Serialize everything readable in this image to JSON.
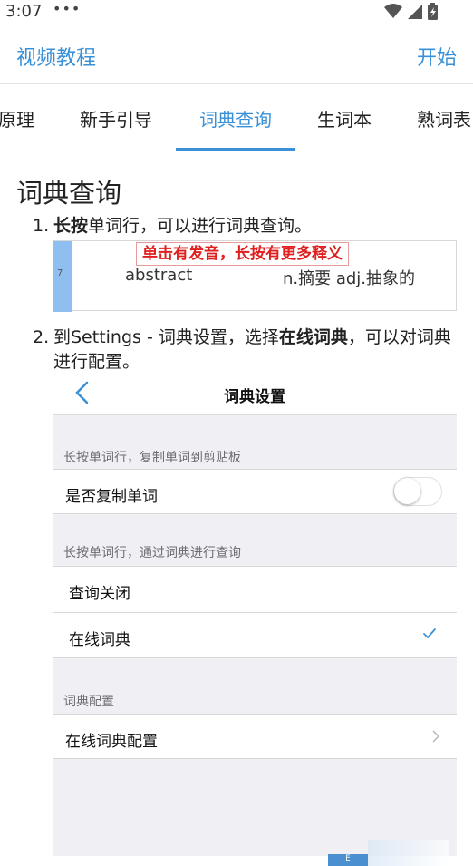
{
  "status_bar": {
    "time": "3:07",
    "dots": "•••"
  },
  "header": {
    "title": "视频教程",
    "action": "开始"
  },
  "tabs": [
    {
      "label": "原理"
    },
    {
      "label": "新手引导"
    },
    {
      "label": "词典查询",
      "active": true
    },
    {
      "label": "生词本"
    },
    {
      "label": "熟词表"
    }
  ],
  "section_title": "词典查询",
  "steps": [
    {
      "num": "1.",
      "bold": "长按",
      "rest": "单词行，可以进行词典查询。"
    },
    {
      "num": "2.",
      "pre": "到Settings - 词典设置，选择",
      "bold": "在线词典",
      "post": "，可以对词典进行配置。"
    }
  ],
  "demo_row": {
    "line_number": "7",
    "tip": "单击有发音，长按有更多释义",
    "word": "abstract",
    "meaning": "n.摘要 adj.抽象的"
  },
  "settings": {
    "title": "词典设置",
    "group1_header": "长按单词行，复制单词到剪贴板",
    "copy_word_label": "是否复制单词",
    "copy_word_enabled": false,
    "group2_header": "长按单词行，通过词典进行查询",
    "option_off": "查询关闭",
    "option_online": "在线词典",
    "selected_option": "在线词典",
    "group3_header": "词典配置",
    "config_label": "在线词典配置"
  },
  "bottom_fragment": "E",
  "colors": {
    "accent": "#3a90d6",
    "tip_red": "#e02020",
    "stripe": "#8fbff0"
  }
}
